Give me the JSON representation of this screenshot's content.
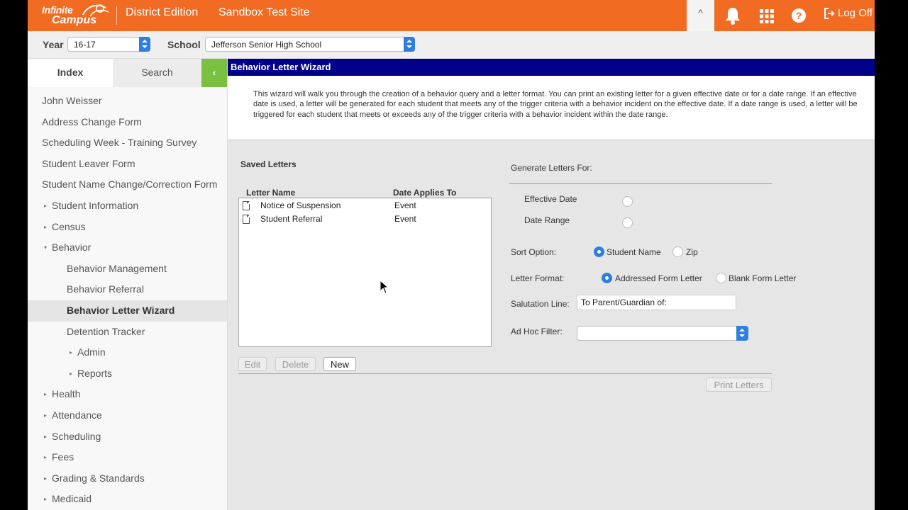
{
  "header": {
    "logo_line1": "Infinite",
    "logo_line2": "Campus",
    "edition": "District Edition",
    "site": "Sandbox Test Site",
    "collapse_caret": "^",
    "logoff_label": "Log Off",
    "accent_color": "#f26b22"
  },
  "context": {
    "year_label": "Year",
    "year_value": "16-17",
    "school_label": "School",
    "school_value": "Jefferson Senior High School"
  },
  "sidebar": {
    "tab_index": "Index",
    "tab_search": "Search",
    "collapse_icon": "‹",
    "items": [
      {
        "label": "John Weisser",
        "arrow": ""
      },
      {
        "label": "Address Change Form",
        "arrow": ""
      },
      {
        "label": "Scheduling Week - Training Survey",
        "arrow": ""
      },
      {
        "label": "Student Leaver Form",
        "arrow": ""
      },
      {
        "label": "Student Name Change/Correction Form",
        "arrow": ""
      },
      {
        "label": "Student Information",
        "arrow": "▸"
      },
      {
        "label": "Census",
        "arrow": "▸"
      },
      {
        "label": "Behavior",
        "arrow": "▾"
      },
      {
        "label": "Behavior Management",
        "arrow": ""
      },
      {
        "label": "Behavior Referral",
        "arrow": ""
      },
      {
        "label": "Behavior Letter Wizard",
        "arrow": ""
      },
      {
        "label": "Detention Tracker",
        "arrow": ""
      },
      {
        "label": "Admin",
        "arrow": "▸"
      },
      {
        "label": "Reports",
        "arrow": "▸"
      },
      {
        "label": "Health",
        "arrow": "▸"
      },
      {
        "label": "Attendance",
        "arrow": "▸"
      },
      {
        "label": "Scheduling",
        "arrow": "▸"
      },
      {
        "label": "Fees",
        "arrow": "▸"
      },
      {
        "label": "Grading & Standards",
        "arrow": "▸"
      },
      {
        "label": "Medicaid",
        "arrow": "▸"
      }
    ]
  },
  "main": {
    "title": "Behavior Letter Wizard",
    "description": "This wizard will walk you through the creation of a behavior query and a letter format. You can print an existing letter for a given effective date or for a date range. If an effective date is used, a letter will be generated for each student that meets any of the trigger criteria with a behavior incident on the effective date. If a date range is used, a letter will be triggered for each student that meets or exceeds any of the trigger criteria with a behavior incident within the date range.",
    "saved_letters_title": "Saved Letters",
    "col_letter_name": "Letter Name",
    "col_date_applies": "Date Applies To",
    "letters": [
      {
        "name": "Notice of Suspension",
        "applies": "Event"
      },
      {
        "name": "Student Referral",
        "applies": "Event"
      }
    ],
    "btn_edit": "Edit",
    "btn_delete": "Delete",
    "btn_new": "New",
    "btn_print": "Print Letters",
    "generate_title": "Generate Letters For:",
    "effective_date_label": "Effective Date",
    "date_range_label": "Date Range",
    "sort_option_label": "Sort Option:",
    "sort_student_name": "Student Name",
    "sort_zip": "Zip",
    "letter_format_label": "Letter Format:",
    "format_addressed": "Addressed Form Letter",
    "format_blank": "Blank Form Letter",
    "salutation_label": "Salutation Line:",
    "salutation_value": "To Parent/Guardian of:",
    "adhoc_label": "Ad Hoc Filter:"
  }
}
